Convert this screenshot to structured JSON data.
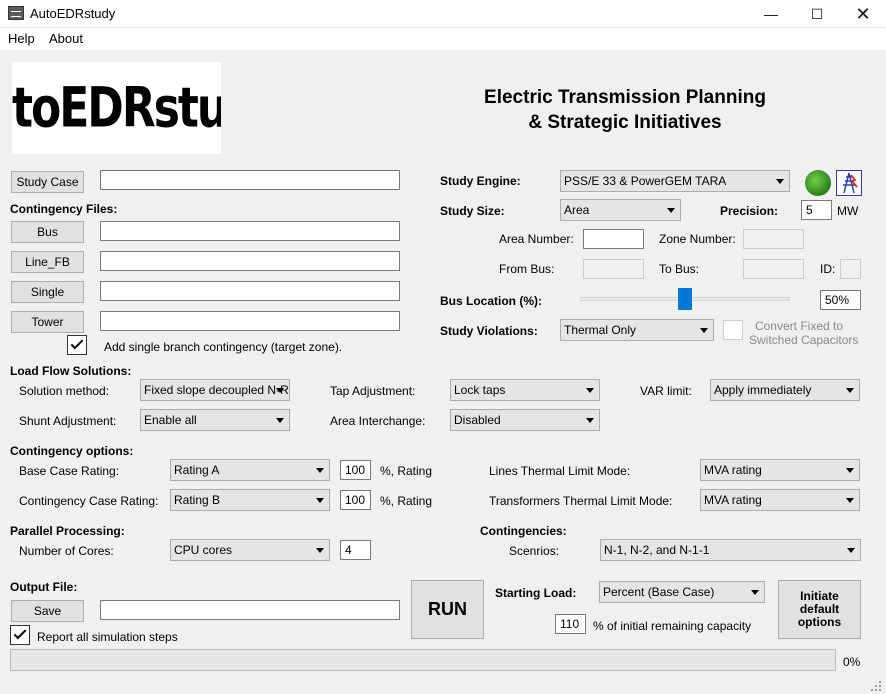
{
  "window": {
    "title": "AutoEDRstudy"
  },
  "menu": {
    "help": "Help",
    "about": "About"
  },
  "logo": {
    "text": "AutoEDRstudy"
  },
  "header": {
    "line1": "Electric Transmission Planning",
    "line2": "& Strategic Initiatives"
  },
  "study_case": {
    "button": "Study Case",
    "value": ""
  },
  "contingency_files": {
    "heading": "Contingency Files:",
    "bus": {
      "button": "Bus",
      "value": ""
    },
    "line_fb": {
      "button": "Line_FB",
      "value": ""
    },
    "single": {
      "button": "Single",
      "value": ""
    },
    "tower": {
      "button": "Tower",
      "value": ""
    },
    "add_single_label": "Add single branch contingency (target zone).",
    "add_single_checked": true
  },
  "study_engine": {
    "label": "Study Engine:",
    "value": "PSS/E 33  & PowerGEM TARA"
  },
  "study_size": {
    "label": "Study Size:",
    "value": "Area"
  },
  "precision": {
    "label": "Precision:",
    "value": "5",
    "unit": "MW"
  },
  "area_number": {
    "label": "Area Number:",
    "value": ""
  },
  "zone_number": {
    "label": "Zone Number:",
    "value": ""
  },
  "from_bus": {
    "label": "From Bus:",
    "value": ""
  },
  "to_bus": {
    "label": "To Bus:",
    "value": ""
  },
  "id_field": {
    "label": "ID:",
    "value": ""
  },
  "bus_location": {
    "label": "Bus Location (%):",
    "value": "50%",
    "level": 0.5
  },
  "study_violations": {
    "label": "Study Violations:",
    "value": "Thermal Only"
  },
  "convert_fixed": {
    "line1": "Convert Fixed to",
    "line2": "Switched Capacitors",
    "checked": false
  },
  "load_flow": {
    "heading": "Load Flow Solutions:",
    "solution_method": {
      "label": "Solution method:",
      "value": "Fixed slope decoupled N-R"
    },
    "tap_adjustment": {
      "label": "Tap Adjustment:",
      "value": "Lock taps"
    },
    "var_limit": {
      "label": "VAR limit:",
      "value": "Apply immediately"
    },
    "shunt_adjustment": {
      "label": "Shunt Adjustment:",
      "value": "Enable all"
    },
    "area_interchange": {
      "label": "Area Interchange:",
      "value": "Disabled"
    }
  },
  "contingency_options": {
    "heading": "Contingency options:",
    "base_case_rating": {
      "label": "Base Case Rating:",
      "value": "Rating A",
      "percent": "100",
      "suffix": "%, Rating"
    },
    "contingency_case_rating": {
      "label": "Contingency Case Rating:",
      "value": "Rating B",
      "percent": "100",
      "suffix": "%, Rating"
    },
    "lines_thermal": {
      "label": "Lines Thermal Limit Mode:",
      "value": "MVA rating"
    },
    "transformers_thermal": {
      "label": "Transformers Thermal Limit Mode:",
      "value": "MVA rating"
    }
  },
  "parallel": {
    "heading": "Parallel Processing:",
    "cores_label": "Number of Cores:",
    "cores_mode": "CPU cores",
    "cores_value": "4"
  },
  "contingencies": {
    "heading": "Contingencies:",
    "scenarios_label": "Scenrios:",
    "scenarios_value": "N-1, N-2, and N-1-1"
  },
  "output": {
    "heading": "Output File:",
    "save_button": "Save",
    "value": "",
    "report_label": "Report all simulation steps",
    "report_checked": true
  },
  "run_button": "RUN",
  "starting_load": {
    "label": "Starting Load:",
    "value": "Percent (Base Case)",
    "amount": "110",
    "amount_label": "% of initial remaining capacity"
  },
  "initiate_button": "Initiate default options",
  "progress": {
    "value": 0,
    "text": "0%"
  }
}
